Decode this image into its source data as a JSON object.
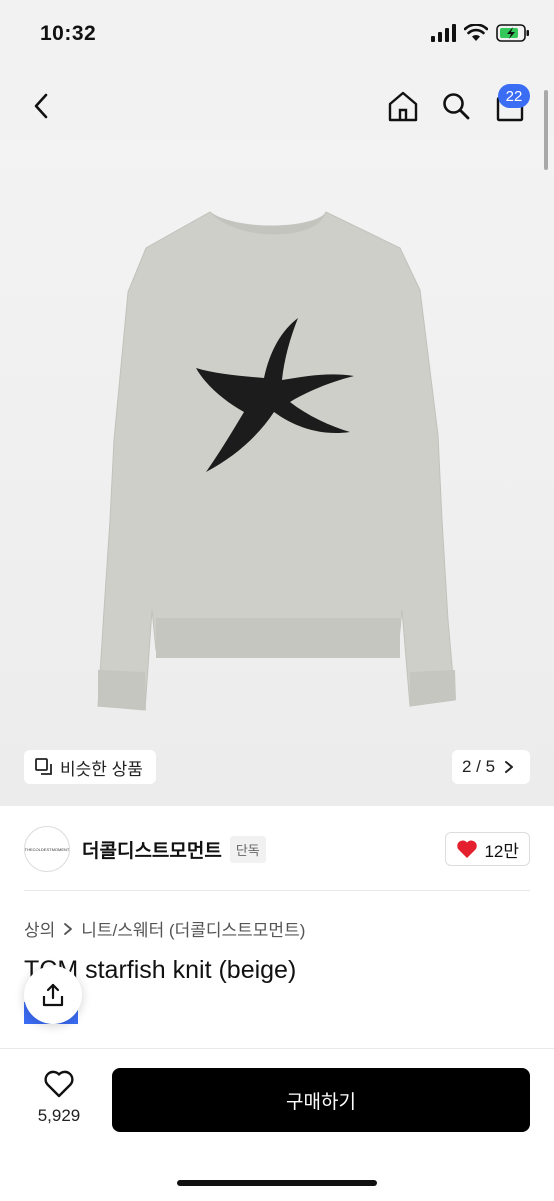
{
  "status_bar": {
    "time": "10:32"
  },
  "nav": {
    "cart_badge": "22"
  },
  "hero": {
    "similar_label": "비슷한 상품",
    "pager": "2 / 5"
  },
  "brand": {
    "name": "더콜디스트모먼트",
    "tag": "단독",
    "logo_text": "THECOLDESTMOMENT",
    "likes": "12만"
  },
  "breadcrumb": {
    "level1": "상의",
    "level2": "니트/스웨터 (더콜디스트모먼트)"
  },
  "product": {
    "title": "TCM starfish knit (beige)"
  },
  "bottom": {
    "wish_count": "5,929",
    "buy_label": "구매하기"
  },
  "colors": {
    "accent": "#3b6cf4",
    "sweater": "#cfcfca",
    "starfish": "#1c1c1c",
    "heart": "#e5202e"
  }
}
